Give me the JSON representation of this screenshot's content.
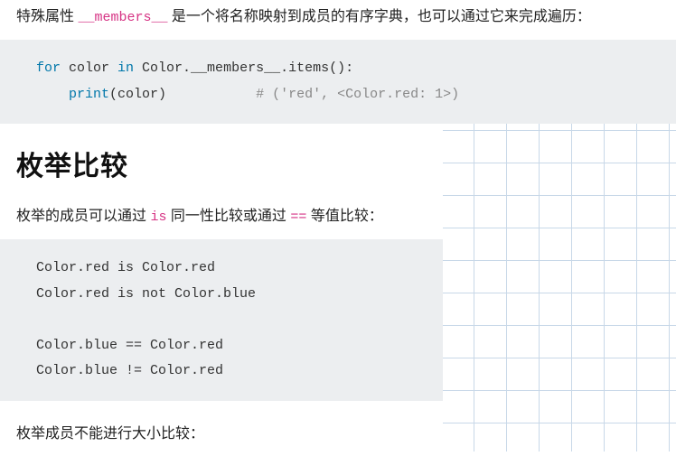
{
  "intro": {
    "prefix": "特殊属性 ",
    "attr": "__members__",
    "suffix": " 是一个将名称映射到成员的有序字典，也可以通过它来完成遍历："
  },
  "code1": {
    "kw_for": "for",
    "var": " color ",
    "kw_in": "in",
    "rest": " Color.__members__.items():",
    "line2_indent": "    ",
    "line2_call": "print",
    "line2_rest": "(color)           ",
    "line2_comment": "# ('red', <Color.red: 1>)"
  },
  "heading": "枚举比较",
  "para2": {
    "p1": "枚举的成员可以通过 ",
    "is_kw": "is",
    "p2": " 同一性比较或通过 ",
    "eq_kw": "==",
    "p3": " 等值比较："
  },
  "code2": {
    "l1": "Color.red is Color.red",
    "l2": "Color.red is not Color.blue",
    "l3": "",
    "l4": "Color.blue == Color.red",
    "l5": "Color.blue != Color.red"
  },
  "para3": "枚举成员不能进行大小比较："
}
